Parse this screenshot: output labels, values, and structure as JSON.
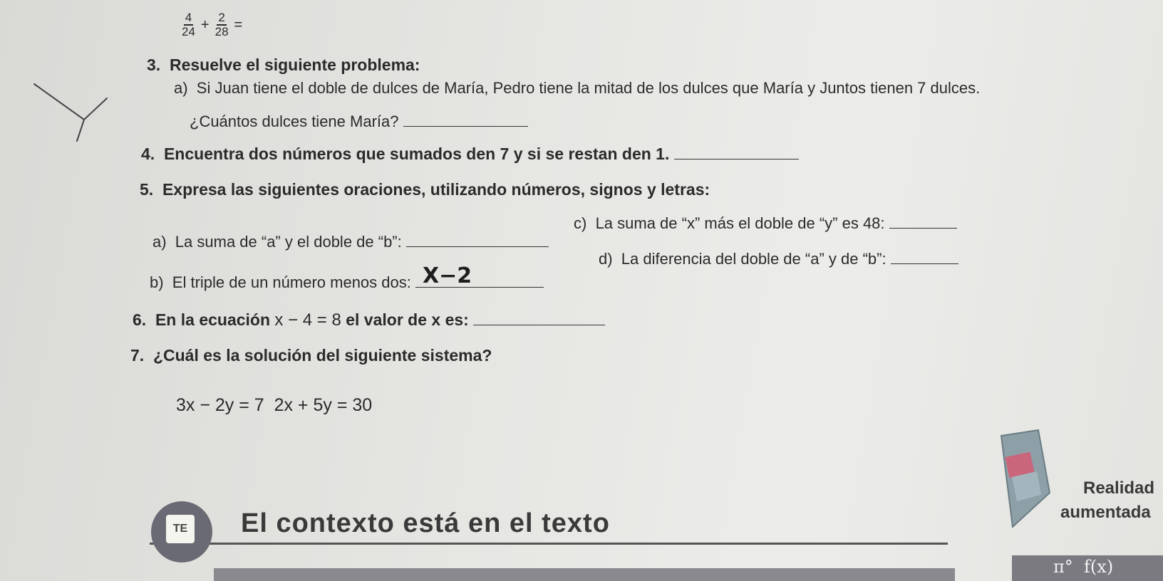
{
  "fraction": {
    "num1": "4",
    "den1": "24",
    "op": "+",
    "num2": "2",
    "den2": "28",
    "eq": "="
  },
  "q3": {
    "number": "3.",
    "title": "Resuelve el siguiente problema:",
    "a_label": "a)",
    "a_text": "Si Juan tiene el doble de dulces de María, Pedro tiene la mitad de los dulces que María y Juntos tienen 7 dulces.",
    "a_question": "¿Cuántos dulces tiene María?"
  },
  "q4": {
    "number": "4.",
    "text": "Encuentra dos números que sumados den 7 y si se restan den 1."
  },
  "q5": {
    "number": "5.",
    "title": "Expresa las siguientes oraciones, utilizando números, signos y letras:",
    "a_label": "a)",
    "a_text": "La suma de “a” y el doble de “b”:",
    "b_label": "b)",
    "b_text": "El triple de un número menos dos:",
    "b_answer": "X−2",
    "c_label": "c)",
    "c_text": "La suma de “x” más el doble de “y” es 48:",
    "d_label": "d)",
    "d_text": "La diferencia del doble de “a” y de “b”:"
  },
  "q6": {
    "number": "6.",
    "text_before": "En la ecuación",
    "equation": "x − 4 = 8",
    "text_after": "el valor de x es:"
  },
  "q7": {
    "number": "7.",
    "title": "¿Cuál es la solución del siguiente sistema?",
    "system": "3x − 2y = 7  2x + 5y = 30"
  },
  "footer": {
    "icon_text": "TE",
    "context_title": "El contexto está en el texto",
    "ar_line1": "Realidad",
    "ar_line2": "aumentada",
    "math_symbols": "π°  f(x)"
  },
  "colors": {
    "paper": "#e6e6e3",
    "ink": "#2b2b2b",
    "icon_circle": "#6a6a74",
    "ar_tablet": "#8da0a8",
    "ar_pink": "#c9667c"
  }
}
